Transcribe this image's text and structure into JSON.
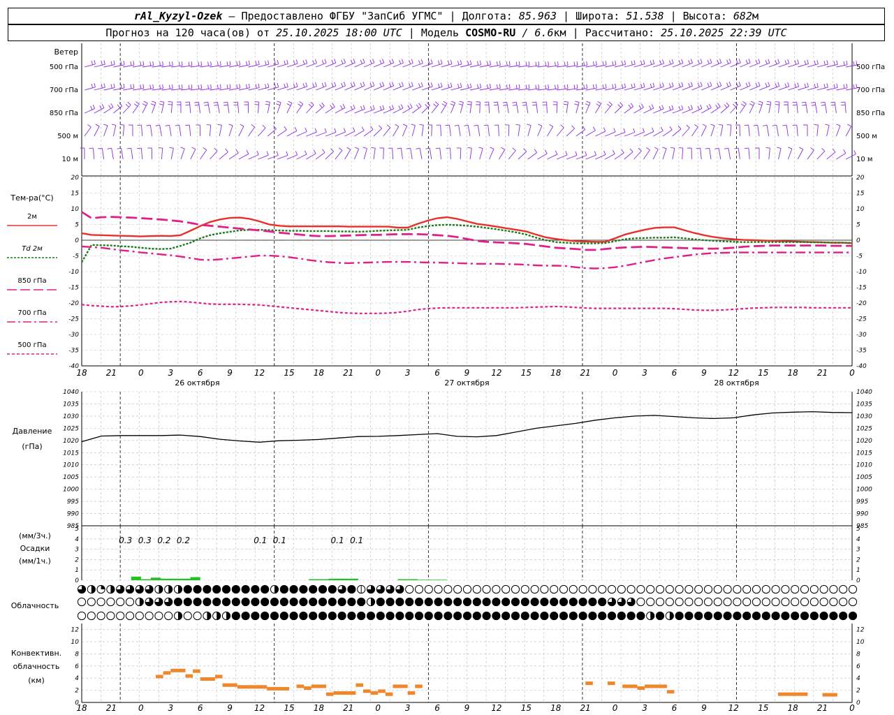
{
  "header": {
    "station": "rAl_Kyzyl-Ozek",
    "provider": " — Предоставлено ФГБУ \"ЗапСиб УГМС\" ",
    "lon_label": "Долгота:",
    "lon_value": "85.963",
    "lat_label": "Широта:",
    "lat_value": "51.538",
    "alt_label": "Высота:",
    "alt_value": "682",
    "alt_unit": "м",
    "forecast_prefix": "Прогноз на 120 часа(ов) от ",
    "forecast_from": "25.10.2025 18:00 UTC",
    "model_label": "Модель ",
    "model_name": "COSMO-RU",
    "model_res": " / 6.6",
    "model_res_unit": "км",
    "calc_label": "Рассчитано: ",
    "calc_time": "25.10.2025 22:39 UTC"
  },
  "wind_panel": {
    "title": "Ветер",
    "levels": [
      "500 гПа",
      "700 гПа",
      "850 гПа",
      "500  м",
      "10  м"
    ],
    "levels_right": [
      "500 гПа",
      "700 гПа",
      "850 гПа",
      "500 м",
      "10 м"
    ]
  },
  "x_axis": {
    "hours": [
      "18",
      "21",
      "0",
      "3",
      "6",
      "9",
      "12",
      "15",
      "18",
      "21",
      "0",
      "3",
      "6",
      "9",
      "12",
      "15",
      "18",
      "21",
      "0",
      "3",
      "6",
      "9",
      "12",
      "15",
      "18",
      "21",
      "0"
    ],
    "days": [
      "26 октября",
      "27 октября",
      "28 октября"
    ]
  },
  "temp_panel": {
    "ylabel": "Тем-ра(°C)",
    "legend": [
      {
        "label": "2м",
        "color": "#e8302a"
      },
      {
        "label": "Td  2м",
        "color": "#1a7a1a"
      },
      {
        "label": "850 гПа",
        "color": "#e0208a"
      },
      {
        "label": "700 гПа",
        "color": "#e0208a"
      },
      {
        "label": "500 гПа",
        "color": "#e0208a"
      }
    ],
    "yticks": [
      "20",
      "15",
      "10",
      "5",
      "0",
      "-5",
      "-10",
      "-15",
      "-20",
      "-25",
      "-30",
      "-35",
      "-40"
    ]
  },
  "pressure_panel": {
    "ylabel": "Давление",
    "yunit": "(гПа)",
    "yticks": [
      "1040",
      "1035",
      "1030",
      "1025",
      "1020",
      "1015",
      "1010",
      "1005",
      "1000",
      "995",
      "990",
      "985"
    ]
  },
  "precip_panel": {
    "ylabel1": "(мм/3ч.)",
    "ylabel2": "Осадки",
    "ylabel3": "(мм/1ч.)",
    "yticks": [
      "5",
      "4",
      "3",
      "2",
      "1",
      "0"
    ],
    "labels": [
      {
        "h": 6,
        "text": "0.3"
      },
      {
        "h": 9,
        "text": "0.3"
      },
      {
        "h": 12,
        "text": "0.2"
      },
      {
        "h": 15,
        "text": "0.2"
      },
      {
        "h": 27,
        "text": "0.1"
      },
      {
        "h": 30,
        "text": "0.1"
      },
      {
        "h": 39,
        "text": "0.1"
      },
      {
        "h": 42,
        "text": "0.1"
      }
    ]
  },
  "cloud_panel": {
    "ylabel": "Облачность"
  },
  "conv_panel": {
    "ylabel1": "Конвективн.",
    "ylabel2": "облачность",
    "ylabel3": "(км)",
    "yticks": [
      "12",
      "10",
      "8",
      "6",
      "4",
      "2",
      "0"
    ]
  },
  "chart_data": [
    {
      "type": "line",
      "title": "Тем-ра(°C)",
      "x_hours": [
        0,
        3,
        6,
        9,
        12,
        15,
        18,
        21,
        24,
        27,
        30,
        33,
        36,
        39,
        42,
        45,
        48,
        51,
        54,
        57,
        60,
        63,
        66,
        69,
        72,
        75,
        78,
        81,
        84,
        87,
        90,
        93,
        96,
        99,
        102,
        105,
        108,
        111,
        114,
        117,
        120,
        123,
        126,
        129,
        132,
        135,
        138,
        141,
        144,
        147,
        150,
        153,
        156,
        159,
        162,
        165,
        168,
        171,
        174,
        177,
        180,
        183,
        186,
        189,
        192,
        195,
        198,
        201,
        204,
        207,
        210,
        213,
        216,
        219,
        222,
        225,
        228,
        231,
        234
      ],
      "ylim": [
        -40,
        20
      ],
      "series": [
        {
          "name": "2м",
          "color": "#e8302a",
          "dash": "solid",
          "values": [
            2.2,
            1.7,
            1.6,
            1.5,
            1.4,
            1.3,
            1.2,
            1.3,
            1.4,
            1.3,
            1.6,
            3.0,
            4.5,
            5.8,
            6.6,
            7.1,
            7.2,
            6.8,
            6.0,
            5.0,
            4.6,
            4.4,
            4.4,
            4.4,
            4.4,
            4.4,
            4.4,
            4.3,
            4.3,
            4.3,
            4.3,
            4.3,
            4.0,
            4.0,
            5.2,
            6.2,
            7.0,
            7.3,
            6.8,
            6.0,
            5.2,
            4.8,
            4.3,
            3.8,
            3.3,
            2.8,
            1.8,
            0.9,
            0.4,
            0.0,
            -0.3,
            -0.4,
            -0.5,
            -0.5,
            0.6,
            1.8,
            2.6,
            3.3,
            3.9,
            4.1,
            4.1,
            3.2,
            2.3,
            1.6,
            1.0,
            0.6,
            0.3,
            0.1,
            0.0,
            -0.1,
            -0.2,
            -0.3,
            -0.4,
            -0.5,
            -0.6,
            -0.7,
            -0.8,
            -0.8,
            -0.9
          ]
        },
        {
          "name": "Td  2м",
          "color": "#1a7a1a",
          "dash": "dotted",
          "values": [
            -7.0,
            -1.5,
            -1.6,
            -1.7,
            -1.9,
            -2.1,
            -2.4,
            -2.7,
            -2.8,
            -2.7,
            -1.8,
            -0.8,
            0.6,
            1.6,
            2.2,
            2.7,
            3.1,
            3.3,
            3.3,
            3.2,
            3.1,
            3.0,
            3.0,
            2.9,
            2.9,
            2.9,
            2.8,
            2.8,
            2.7,
            2.8,
            3.0,
            3.1,
            3.2,
            3.3,
            4.0,
            4.5,
            4.8,
            4.9,
            4.8,
            4.6,
            4.3,
            3.9,
            3.5,
            3.0,
            2.5,
            1.8,
            0.8,
            0.0,
            -0.6,
            -0.8,
            -1.0,
            -1.0,
            -1.0,
            -0.9,
            -0.3,
            0.3,
            0.6,
            0.7,
            0.8,
            0.8,
            0.9,
            0.6,
            0.3,
            0.0,
            -0.2,
            -0.4,
            -0.5,
            -0.6,
            -0.6,
            -0.6,
            -0.6,
            -0.6,
            -0.6,
            -0.6,
            -0.7,
            -0.7,
            -0.8,
            -0.8,
            -0.9
          ]
        },
        {
          "name": "850 гПа",
          "color": "#e0208a",
          "dash": "longdash",
          "values": [
            9.0,
            7.0,
            7.3,
            7.4,
            7.3,
            7.2,
            7.0,
            6.8,
            6.6,
            6.3,
            6.0,
            5.5,
            4.9,
            4.6,
            4.3,
            4.0,
            3.7,
            3.4,
            3.1,
            2.8,
            2.4,
            2.1,
            1.8,
            1.5,
            1.3,
            1.3,
            1.4,
            1.5,
            1.6,
            1.7,
            1.7,
            1.8,
            1.9,
            1.9,
            1.9,
            1.8,
            1.6,
            1.4,
            1.0,
            0.4,
            -0.2,
            -0.5,
            -0.7,
            -0.8,
            -1.0,
            -1.2,
            -1.6,
            -2.0,
            -2.4,
            -2.6,
            -2.8,
            -3.1,
            -3.1,
            -2.8,
            -2.5,
            -2.3,
            -2.2,
            -2.1,
            -2.2,
            -2.3,
            -2.4,
            -2.5,
            -2.6,
            -2.7,
            -2.7,
            -2.6,
            -2.4,
            -2.1,
            -1.9,
            -1.8,
            -1.7,
            -1.7,
            -1.7,
            -1.7,
            -1.7,
            -1.7,
            -1.8,
            -1.8,
            -1.8
          ]
        },
        {
          "name": "700 гПа",
          "color": "#e0208a",
          "dash": "dashdot",
          "values": [
            -2.0,
            -2.2,
            -2.4,
            -2.8,
            -3.2,
            -3.5,
            -3.9,
            -4.2,
            -4.5,
            -4.8,
            -5.2,
            -5.7,
            -6.2,
            -6.3,
            -6.1,
            -5.8,
            -5.5,
            -5.2,
            -4.9,
            -4.9,
            -5.1,
            -5.4,
            -5.8,
            -6.3,
            -6.7,
            -7.0,
            -7.2,
            -7.3,
            -7.2,
            -7.1,
            -7.0,
            -6.9,
            -6.9,
            -6.9,
            -7.0,
            -7.1,
            -7.1,
            -7.2,
            -7.3,
            -7.4,
            -7.5,
            -7.5,
            -7.5,
            -7.6,
            -7.7,
            -7.8,
            -8.0,
            -8.1,
            -8.1,
            -8.2,
            -8.6,
            -8.9,
            -9.0,
            -8.9,
            -8.6,
            -8.1,
            -7.5,
            -6.9,
            -6.3,
            -5.8,
            -5.4,
            -5.0,
            -4.6,
            -4.3,
            -4.1,
            -4.0,
            -3.9,
            -3.9,
            -3.9,
            -3.9,
            -3.9,
            -3.9,
            -3.9,
            -3.9,
            -3.9,
            -3.9,
            -3.9,
            -3.9,
            -3.9
          ]
        },
        {
          "name": "500 гПа",
          "color": "#e0208a",
          "dash": "dash",
          "values": [
            -20.5,
            -20.8,
            -21.0,
            -21.2,
            -21.1,
            -20.9,
            -20.6,
            -20.2,
            -19.8,
            -19.6,
            -19.5,
            -19.7,
            -20.0,
            -20.3,
            -20.4,
            -20.4,
            -20.4,
            -20.5,
            -20.6,
            -20.9,
            -21.2,
            -21.5,
            -21.8,
            -22.1,
            -22.4,
            -22.7,
            -23.0,
            -23.2,
            -23.3,
            -23.3,
            -23.3,
            -23.2,
            -23.0,
            -22.6,
            -22.1,
            -21.8,
            -21.6,
            -21.5,
            -21.5,
            -21.5,
            -21.5,
            -21.5,
            -21.5,
            -21.5,
            -21.5,
            -21.4,
            -21.3,
            -21.2,
            -21.1,
            -21.2,
            -21.4,
            -21.6,
            -21.7,
            -21.7,
            -21.7,
            -21.7,
            -21.7,
            -21.7,
            -21.7,
            -21.7,
            -21.8,
            -22.0,
            -22.2,
            -22.3,
            -22.3,
            -22.2,
            -22.0,
            -21.8,
            -21.6,
            -21.5,
            -21.4,
            -21.4,
            -21.4,
            -21.4,
            -21.5,
            -21.5,
            -21.5,
            -21.5,
            -21.5
          ]
        }
      ]
    },
    {
      "type": "line",
      "title": "Давление",
      "ylim": [
        985,
        1040
      ],
      "x_hours": [
        0,
        6,
        12,
        18,
        24,
        30,
        36,
        42,
        48,
        54,
        60,
        66,
        72,
        78,
        84,
        90,
        96,
        102,
        108,
        114,
        120,
        126,
        132,
        138,
        144,
        150,
        156,
        162,
        168,
        174,
        180,
        186,
        192,
        198,
        204,
        210,
        216,
        222,
        228,
        234
      ],
      "series": [
        {
          "name": "",
          "color": "#000000",
          "values": [
            1019.5,
            1021.8,
            1022.0,
            1022.0,
            1022.0,
            1022.2,
            1021.6,
            1020.5,
            1019.8,
            1019.3,
            1019.9,
            1020.1,
            1020.4,
            1021.0,
            1021.6,
            1021.7,
            1022.0,
            1022.4,
            1022.8,
            1021.7,
            1021.5,
            1022.0,
            1023.5,
            1025.0,
            1026.0,
            1027.0,
            1028.3,
            1029.3,
            1030.0,
            1030.3,
            1029.8,
            1029.3,
            1029.0,
            1029.3,
            1030.5,
            1031.3,
            1031.6,
            1031.8,
            1031.5,
            1031.4
          ]
        }
      ]
    },
    {
      "type": "bar",
      "title": "Осадки",
      "ylim": [
        0,
        5
      ],
      "series": [
        {
          "name": "",
          "color": "#1cc41c",
          "bars_hours": [
            [
              15,
              18,
              0.35
            ],
            [
              18,
              21,
              0.1
            ],
            [
              21,
              24,
              0.25
            ],
            [
              24,
              33,
              0.15
            ],
            [
              33,
              36,
              0.3
            ],
            [
              69,
              75,
              0.1
            ],
            [
              75,
              84,
              0.15
            ],
            [
              96,
              102,
              0.1
            ],
            [
              102,
              111,
              0.05
            ]
          ]
        }
      ]
    },
    {
      "type": "bar",
      "title": "Конвективн. облачность (км)",
      "ylim": [
        0,
        13
      ],
      "series": [
        {
          "name": "",
          "color": "#f0872a",
          "segments": [
            [
              30,
              33,
              4.2
            ],
            [
              33,
              36,
              4.8
            ],
            [
              36,
              42,
              5.2
            ],
            [
              42,
              45,
              4.3
            ],
            [
              45,
              48,
              5.1
            ],
            [
              48,
              54,
              3.8
            ],
            [
              54,
              57,
              4.2
            ],
            [
              57,
              63,
              2.8
            ],
            [
              63,
              75,
              2.5
            ],
            [
              75,
              84,
              2.2
            ],
            [
              87,
              90,
              2.6
            ],
            [
              90,
              93,
              2.3
            ],
            [
              93,
              99,
              2.6
            ],
            [
              99,
              102,
              1.3
            ],
            [
              102,
              111,
              1.5
            ],
            [
              111,
              114,
              2.8
            ],
            [
              114,
              117,
              1.8
            ],
            [
              117,
              120,
              1.5
            ],
            [
              120,
              123,
              1.8
            ],
            [
              123,
              126,
              1.3
            ],
            [
              126,
              132,
              2.6
            ],
            [
              132,
              135,
              1.5
            ],
            [
              135,
              138,
              2.6
            ],
            [
              204,
              207,
              3.1
            ],
            [
              213,
              216,
              3.1
            ],
            [
              219,
              225,
              2.6
            ],
            [
              225,
              228,
              2.3
            ],
            [
              228,
              237,
              2.6
            ],
            [
              237,
              240,
              1.7
            ],
            [
              282,
              294,
              1.3
            ],
            [
              300,
              306,
              1.2
            ]
          ]
        }
      ]
    }
  ],
  "cloud_rows": {
    "row1": "qhthqqqqhhhfffffffffhffffffqf3qqqq0000000000000000000000000000000000000000000000000000000000000000000",
    "row2": "000000hqqqffffffffffffffffffffhffffffffffffffffffffffffqqq00000000000000000000000hqh00000000000000000000",
    "row3": "0000000000h00hhhfffffffffffffffffffffffffffffffffffffffffffhfhfffffffffffffffffffffffffffffffffffffffff"
  }
}
